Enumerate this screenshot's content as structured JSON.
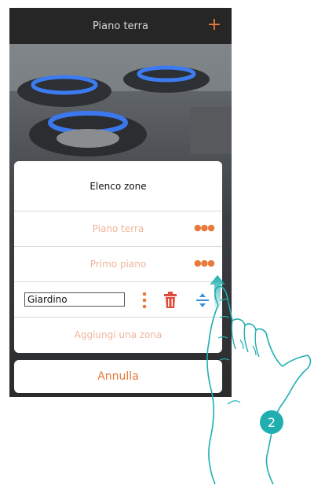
{
  "header": {
    "title": "Piano terra",
    "add_icon": "plus-icon",
    "accent": "#e8793a"
  },
  "dialog": {
    "title": "Elenco zone",
    "zones": [
      {
        "label": "Piano terra",
        "menu_icon": "more-horizontal-icon"
      },
      {
        "label": "Primo piano",
        "menu_icon": "more-horizontal-icon"
      }
    ],
    "edit_zone": {
      "value": "Giardino",
      "icons": [
        "more-vertical-icon",
        "trash-icon",
        "reorder-icon"
      ]
    },
    "add_zone_label": "Aggiungi una zona"
  },
  "cancel_label": "Annulla",
  "step_badge": "2",
  "colors": {
    "accent": "#e8793a",
    "faded_text": "#f0b59a",
    "badge": "#20aeb0",
    "reorder": "#3a8fd6"
  }
}
